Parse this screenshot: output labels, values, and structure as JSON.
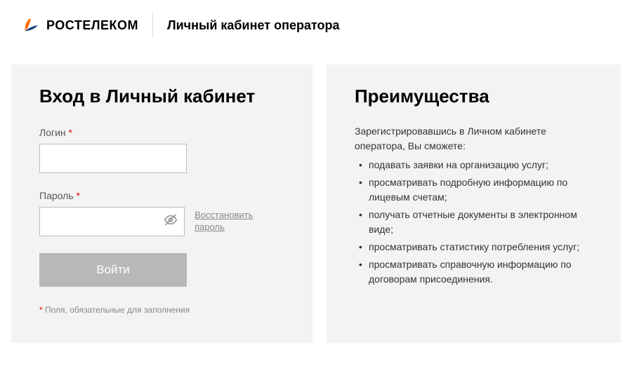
{
  "header": {
    "brand": "РОСТЕЛЕКОМ",
    "subtitle": "Личный кабинет оператора"
  },
  "login": {
    "title": "Вход в Личный кабинет",
    "login_label": "Логин",
    "password_label": "Пароль",
    "forgot_password": "Восстановить пароль",
    "submit_label": "Войти",
    "footnote_marker": "*",
    "footnote_text": " Поля, обязательные для заполнения"
  },
  "benefits": {
    "title": "Преимущества",
    "intro": "Зарегистрировавшись в Личном кабинете оператора, Вы сможете:",
    "items": [
      "подавать заявки на организацию услуг;",
      "просматривать подробную информацию по лицевым счетам;",
      "получать отчетные документы в электронном виде;",
      "просматривать статистику потребления услуг;",
      "просматривать справочную информацию по договорам присоединения."
    ]
  }
}
